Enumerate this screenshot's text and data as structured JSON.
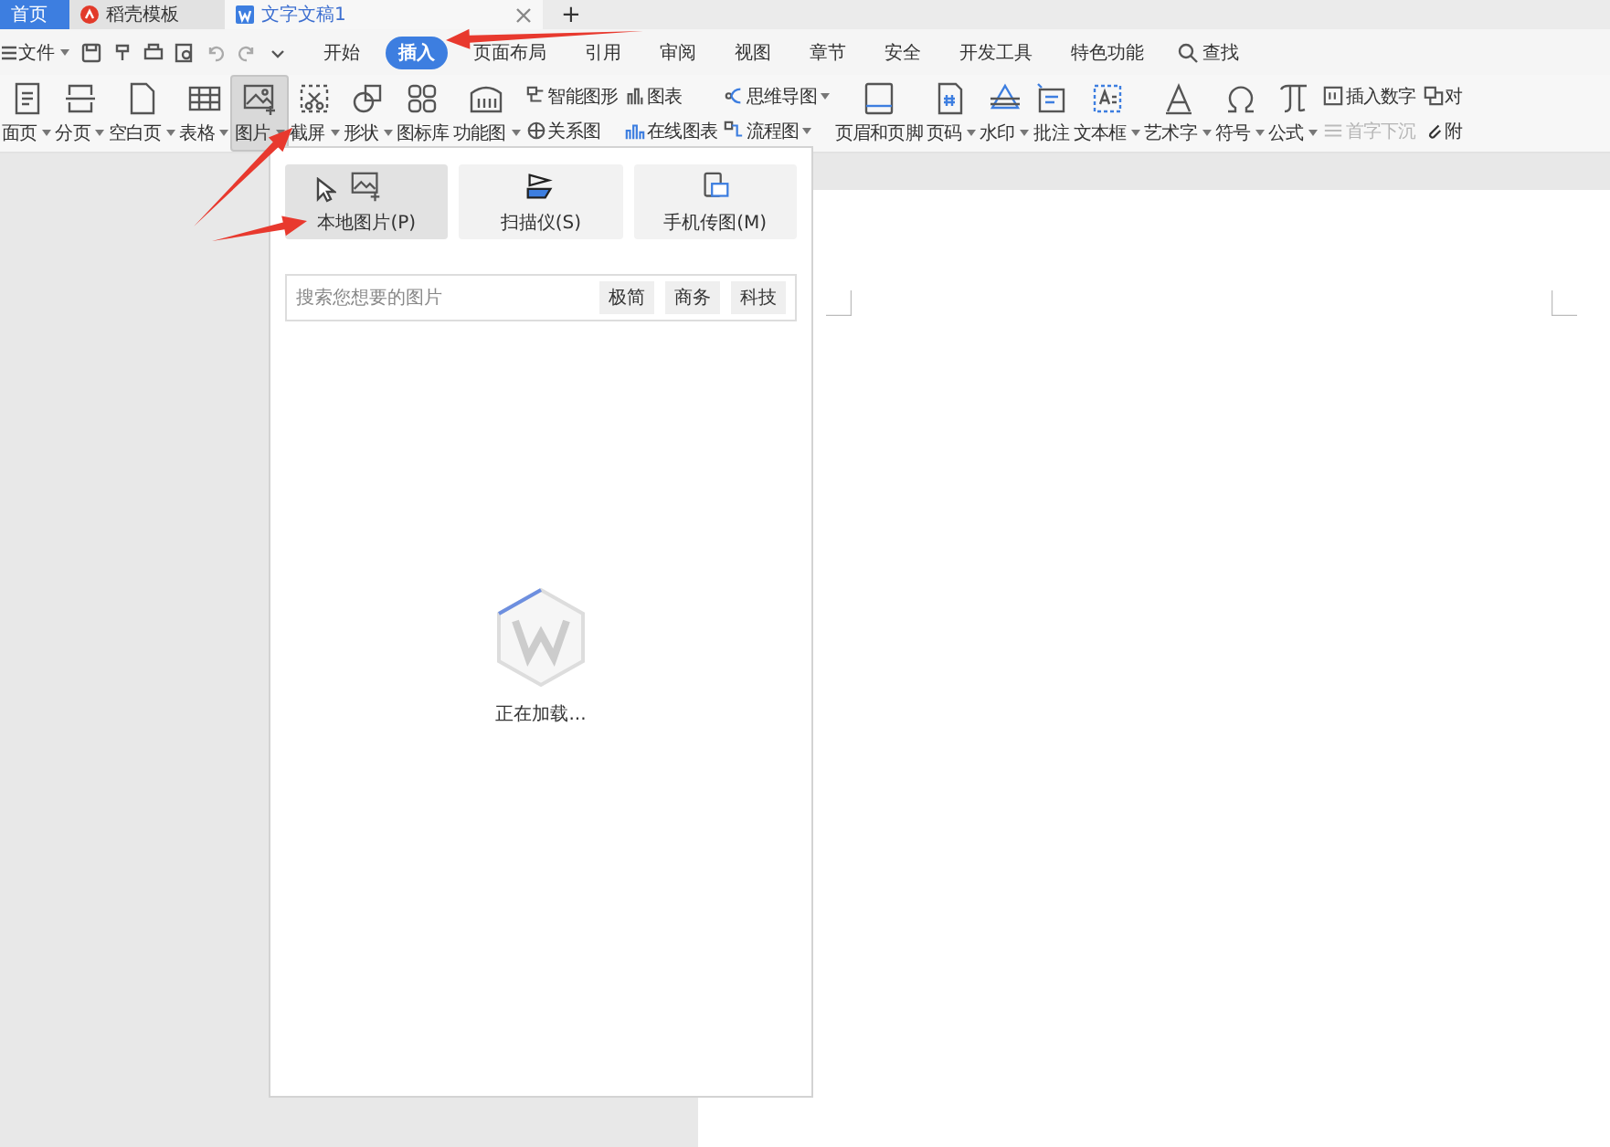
{
  "tabs": [
    {
      "label": "首页",
      "kind": "home",
      "selected": false
    },
    {
      "label": "稻壳模板",
      "kind": "template",
      "selected": false
    },
    {
      "label": "文字文稿1",
      "kind": "document",
      "selected": true
    }
  ],
  "new_tab": "+",
  "menu": {
    "file": "文件",
    "tabs": [
      {
        "label": "开始",
        "selected": false
      },
      {
        "label": "插入",
        "selected": true
      },
      {
        "label": "页面布局",
        "selected": false
      },
      {
        "label": "引用",
        "selected": false
      },
      {
        "label": "审阅",
        "selected": false
      },
      {
        "label": "视图",
        "selected": false
      },
      {
        "label": "章节",
        "selected": false
      },
      {
        "label": "安全",
        "selected": false
      },
      {
        "label": "开发工具",
        "selected": false
      },
      {
        "label": "特色功能",
        "selected": false
      }
    ],
    "search": "查找"
  },
  "ribbon": [
    {
      "kind": "large",
      "label": "面页",
      "dropdown": true,
      "active": false
    },
    {
      "kind": "large",
      "label": "分页",
      "dropdown": true,
      "active": false
    },
    {
      "kind": "large",
      "label": "空白页",
      "dropdown": true,
      "active": false
    },
    {
      "kind": "large",
      "label": "表格",
      "dropdown": true,
      "active": false
    },
    {
      "kind": "large",
      "label": "图片",
      "dropdown": true,
      "active": true
    },
    {
      "kind": "large",
      "label": "截屏",
      "dropdown": true,
      "active": false
    },
    {
      "kind": "large",
      "label": "形状",
      "dropdown": true,
      "active": false
    },
    {
      "kind": "large",
      "label": "图标库",
      "dropdown": false,
      "active": false
    },
    {
      "kind": "large",
      "label": "功能图",
      "dropdown": true,
      "active": false
    },
    {
      "kind": "pair",
      "items": [
        {
          "label": "智能图形",
          "dropdown": false,
          "disabled": false
        },
        {
          "label": "关系图",
          "dropdown": false,
          "disabled": false
        }
      ]
    },
    {
      "kind": "pair",
      "items": [
        {
          "label": "图表",
          "dropdown": false,
          "disabled": false
        },
        {
          "label": "在线图表",
          "dropdown": false,
          "disabled": false
        }
      ]
    },
    {
      "kind": "pair",
      "items": [
        {
          "label": "思维导图",
          "dropdown": true,
          "disabled": false
        },
        {
          "label": "流程图",
          "dropdown": true,
          "disabled": false
        }
      ]
    },
    {
      "kind": "large",
      "label": "页眉和页脚",
      "dropdown": false,
      "active": false
    },
    {
      "kind": "large",
      "label": "页码",
      "dropdown": true,
      "active": false
    },
    {
      "kind": "large",
      "label": "水印",
      "dropdown": true,
      "active": false
    },
    {
      "kind": "large",
      "label": "批注",
      "dropdown": false,
      "active": false
    },
    {
      "kind": "large",
      "label": "文本框",
      "dropdown": true,
      "active": false
    },
    {
      "kind": "large",
      "label": "艺术字",
      "dropdown": true,
      "active": false
    },
    {
      "kind": "large",
      "label": "符号",
      "dropdown": true,
      "active": false
    },
    {
      "kind": "large",
      "label": "公式",
      "dropdown": true,
      "active": false
    },
    {
      "kind": "pair",
      "items": [
        {
          "label": "插入数字",
          "dropdown": false,
          "disabled": false
        },
        {
          "label": "首字下沉",
          "dropdown": false,
          "disabled": true
        }
      ]
    },
    {
      "kind": "pair",
      "items": [
        {
          "label": "对",
          "dropdown": false,
          "disabled": false
        },
        {
          "label": "附",
          "dropdown": false,
          "disabled": false
        }
      ]
    }
  ],
  "picture_panel": {
    "sources": [
      {
        "label": "本地图片(P)",
        "selected": true
      },
      {
        "label": "扫描仪(S)",
        "selected": false
      },
      {
        "label": "手机传图(M)",
        "selected": false
      }
    ],
    "search": {
      "placeholder": "搜索您想要的图片"
    },
    "tags": [
      "极简",
      "商务",
      "科技"
    ],
    "loading": "正在加载..."
  }
}
